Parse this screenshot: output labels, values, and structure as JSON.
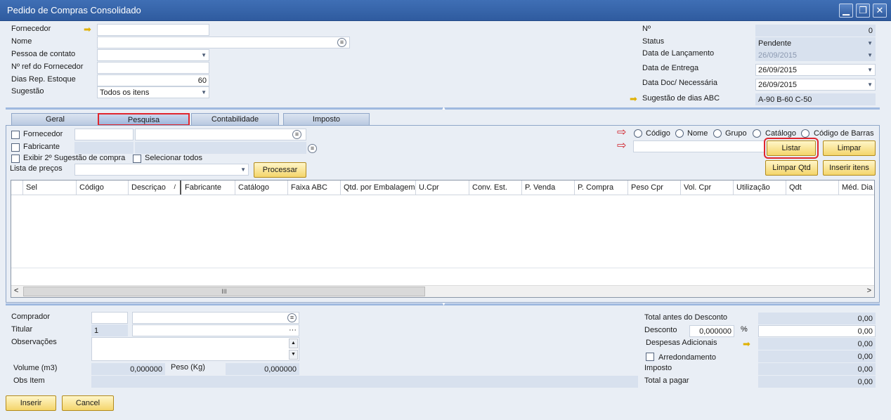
{
  "window": {
    "title": "Pedido de Compras Consolidado",
    "buttons": {
      "minimize": "▁",
      "restore": "❐",
      "close": "✕"
    }
  },
  "header_left": {
    "fornecedor_label": "Fornecedor",
    "nome_label": "Nome",
    "pessoa_contato_label": "Pessoa de contato",
    "ref_fornecedor_label": "Nº ref do Fornecedor",
    "dias_rep_label": "Dias Rep. Estoque",
    "dias_rep_value": "60",
    "sugestao_label": "Sugestão",
    "sugestao_value": "Todos os itens"
  },
  "header_right": {
    "numero_label": "Nº",
    "numero_value": "0",
    "status_label": "Status",
    "status_value": "Pendente",
    "data_lancamento_label": "Data de Lançamento",
    "data_lancamento_value": "26/09/2015",
    "data_entrega_label": "Data de Entrega",
    "data_entrega_value": "26/09/2015",
    "data_doc_label": "Data Doc/ Necessária",
    "data_doc_value": "26/09/2015",
    "sugestao_abc_label": "Sugestão de dias ABC",
    "sugestao_abc_value": "A-90 B-60 C-50"
  },
  "tabs": [
    {
      "label": "Geral"
    },
    {
      "label": "Pesquisa"
    },
    {
      "label": "Contabilidade"
    },
    {
      "label": "Imposto"
    }
  ],
  "pesquisa": {
    "fornecedor_label": "Fornecedor",
    "fabricante_label": "Fabricante",
    "exibir_label": "Exibir 2º Sugestão de compra",
    "selecionar_label": "Selecionar todos",
    "lista_precos_label": "Lista de preços",
    "processar_label": "Processar",
    "search_options": [
      "Código",
      "Nome",
      "Grupo",
      "Catálogo",
      "Código de Barras"
    ],
    "listar_label": "Listar",
    "limpar_label": "Limpar",
    "limpar_qtd_label": "Limpar Qtd",
    "inserir_itens_label": "Inserir itens"
  },
  "grid": {
    "columns": [
      "",
      "Sel",
      "Código",
      "Descriçao",
      "Fabricante",
      "Catálogo",
      "Faixa ABC",
      "Qtd. por Embalagem",
      "U.Cpr",
      "Conv. Est.",
      "P. Venda",
      "P. Compra",
      "Peso Cpr",
      "Vol. Cpr",
      "Utilização",
      "Qdt",
      "Méd. Dia"
    ],
    "sort_indicator": "/",
    "scroll_thumb": "III",
    "scroll_left": "<",
    "scroll_right": ">"
  },
  "footer_left": {
    "comprador_label": "Comprador",
    "titular_label": "Titular",
    "titular_value": "1",
    "observacoes_label": "Observações",
    "volume_label": "Volume (m3)",
    "volume_value": "0,000000",
    "peso_label": "Peso (Kg)",
    "peso_value": "0,000000",
    "obs_item_label": "Obs Item",
    "ellipsis": "···"
  },
  "footer_right": {
    "total_antes_label": "Total antes do Desconto",
    "total_antes_value": "0,00",
    "desconto_label": "Desconto",
    "desconto_pct_value": "0,000000",
    "pct_symbol": "%",
    "desconto_value": "0,00",
    "despesas_label": "Despesas Adicionais",
    "despesas_value": "0,00",
    "arredondamento_label": "Arredondamento",
    "arredondamento_value": "0,00",
    "imposto_label": "Imposto",
    "imposto_value": "0,00",
    "total_pagar_label": "Total a pagar",
    "total_pagar_value": "0,00"
  },
  "actions": {
    "inserir_label": "Inserir",
    "cancelar_label": "Cancel"
  }
}
